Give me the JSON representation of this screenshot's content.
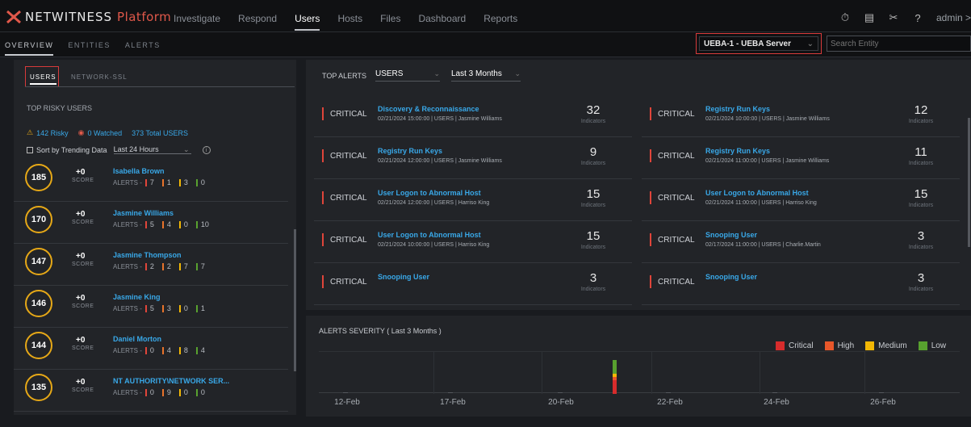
{
  "app": {
    "brand": "NETWITNESS",
    "brand_suffix": "Platform"
  },
  "nav": {
    "links": [
      "Investigate",
      "Respond",
      "Users",
      "Hosts",
      "Files",
      "Dashboard",
      "Reports"
    ],
    "active": "Users",
    "admin_label": "admin >"
  },
  "icons": [
    "stopwatch-icon",
    "notes-icon",
    "tools-icon",
    "help-icon"
  ],
  "subnav": {
    "tabs": [
      "OVERVIEW",
      "ENTITIES",
      "ALERTS"
    ],
    "active": "OVERVIEW"
  },
  "entity_selector": {
    "value": "UEBA-1 - UEBA Server"
  },
  "search": {
    "placeholder": "Search Entity"
  },
  "left": {
    "tabs": [
      "USERS",
      "NETWORK-SSL"
    ],
    "title": "TOP RISKY USERS",
    "stats": {
      "risky": "142 Risky",
      "watched": "0 Watched",
      "total": "373 Total USERS"
    },
    "sort_label": "Sort by Trending Data",
    "sort_range": "Last 24 Hours",
    "score_label": "SCORE",
    "alerts_label": "ALERTS -",
    "users": [
      {
        "score": "185",
        "delta": "+0",
        "name": "Isabella Brown",
        "counts": [
          "7",
          "1",
          "3",
          "0"
        ]
      },
      {
        "score": "170",
        "delta": "+0",
        "name": "Jasmine Williams",
        "counts": [
          "5",
          "4",
          "0",
          "10"
        ]
      },
      {
        "score": "147",
        "delta": "+0",
        "name": "Jasmine Thompson",
        "counts": [
          "2",
          "2",
          "7",
          "7"
        ]
      },
      {
        "score": "146",
        "delta": "+0",
        "name": "Jasmine King",
        "counts": [
          "5",
          "3",
          "0",
          "1"
        ]
      },
      {
        "score": "144",
        "delta": "+0",
        "name": "Daniel Morton",
        "counts": [
          "0",
          "4",
          "8",
          "4"
        ]
      },
      {
        "score": "135",
        "delta": "+0",
        "name": "NT AUTHORITY\\NETWORK SER...",
        "counts": [
          "0",
          "9",
          "0",
          "0"
        ]
      }
    ]
  },
  "top_alerts": {
    "title": "TOP ALERTS",
    "entity_filter": "USERS",
    "range_filter": "Last 3 Months",
    "indicators_label": "Indicators",
    "alerts": [
      {
        "severity": "CRITICAL",
        "name": "Discovery & Reconnaissance",
        "meta": "02/21/2024 15:00:00 | USERS | Jasmine Williams",
        "count": "32"
      },
      {
        "severity": "CRITICAL",
        "name": "Registry Run Keys",
        "meta": "02/21/2024 10:00:00 | USERS | Jasmine Williams",
        "count": "12"
      },
      {
        "severity": "CRITICAL",
        "name": "Registry Run Keys",
        "meta": "02/21/2024 12:00:00 | USERS | Jasmine Williams",
        "count": "9"
      },
      {
        "severity": "CRITICAL",
        "name": "Registry Run Keys",
        "meta": "02/21/2024 11:00:00 | USERS | Jasmine Williams",
        "count": "11"
      },
      {
        "severity": "CRITICAL",
        "name": "User Logon to Abnormal Host",
        "meta": "02/21/2024 12:00:00 | USERS | Harriso King",
        "count": "15"
      },
      {
        "severity": "CRITICAL",
        "name": "User Logon to Abnormal Host",
        "meta": "02/21/2024 11:00:00 | USERS | Harriso King",
        "count": "15"
      },
      {
        "severity": "CRITICAL",
        "name": "User Logon to Abnormal Host",
        "meta": "02/21/2024 10:00:00 | USERS | Harriso King",
        "count": "15"
      },
      {
        "severity": "CRITICAL",
        "name": "Snooping User",
        "meta": "02/17/2024 11:00:00 | USERS | Charlie.Martin",
        "count": "3"
      },
      {
        "severity": "CRITICAL",
        "name": "Snooping User",
        "meta": "",
        "count": "3"
      },
      {
        "severity": "CRITICAL",
        "name": "Snooping User",
        "meta": "",
        "count": "3"
      }
    ]
  },
  "severity_chart": {
    "title": "ALERTS SEVERITY ( Last 3 Months )",
    "legend": [
      {
        "name": "Critical",
        "color": "#d72c2c"
      },
      {
        "name": "High",
        "color": "#e8572a"
      },
      {
        "name": "Medium",
        "color": "#f2b705"
      },
      {
        "name": "Low",
        "color": "#58a12f"
      }
    ],
    "x_labels": [
      "12-Feb",
      "17-Feb",
      "20-Feb",
      "22-Feb",
      "24-Feb",
      "26-Feb"
    ]
  },
  "chart_data": {
    "type": "bar",
    "title": "ALERTS SEVERITY ( Last 3 Months )",
    "categories": [
      "12-Feb",
      "17-Feb",
      "20-Feb",
      "21-Feb",
      "22-Feb",
      "24-Feb",
      "26-Feb"
    ],
    "series": [
      {
        "name": "Critical",
        "values": [
          0,
          0,
          0,
          4,
          0,
          0,
          0
        ]
      },
      {
        "name": "High",
        "values": [
          0,
          0,
          0,
          1,
          0,
          0,
          0
        ]
      },
      {
        "name": "Medium",
        "values": [
          0,
          0,
          0,
          1,
          0,
          0,
          0
        ]
      },
      {
        "name": "Low",
        "values": [
          0,
          0,
          0,
          4,
          0,
          0,
          0
        ]
      }
    ],
    "stacked": true,
    "legend_position": "top-right"
  }
}
